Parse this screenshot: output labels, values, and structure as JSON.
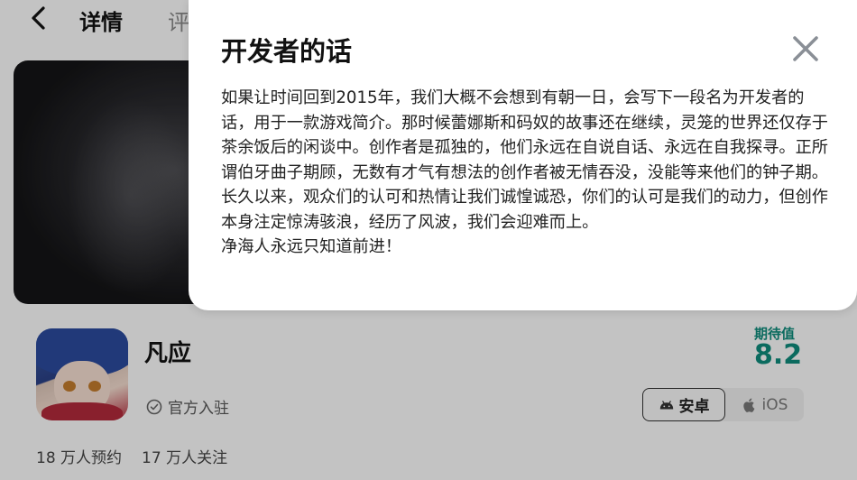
{
  "nav": {
    "back_icon": "chevron-left-icon",
    "tabs": [
      {
        "label": "详情",
        "active": true
      },
      {
        "label": "评"
      }
    ]
  },
  "game": {
    "title": "凡应",
    "verified_label": "官方入驻",
    "expect_label": "期待值",
    "expect_score": "8.2",
    "platforms": [
      {
        "label": "安卓",
        "icon": "android-icon",
        "selected": true
      },
      {
        "label": "iOS",
        "icon": "apple-icon",
        "selected": false
      }
    ],
    "stats": {
      "reservations": "18 万人预约",
      "follows": "17 万人关注"
    }
  },
  "modal": {
    "title": "开发者的话",
    "close_icon": "close-icon",
    "paragraphs": [
      "如果让时间回到2015年，我们大概不会想到有朝一日，会写下一段名为开发者的话，用于一款游戏简介。那时候蕾娜斯和码奴的故事还在继续，灵笼的世界还仅存于茶余饭后的闲谈中。创作者是孤独的，他们永远在自说自话、永远在自我探寻。正所谓伯牙曲子期顾，无数有才气有想法的创作者被无情吞没，没能等来他们的钟子期。长久以来，观众们的认可和热情让我们诚惶诚恐，你们的认可是我们的动力，但创作本身注定惊涛骇浪，经历了风波，我们会迎难而上。",
      "净海人永远只知道前进！"
    ]
  },
  "colors": {
    "accent": "#0f8a7a",
    "tab_underline": "#14b9a4"
  }
}
